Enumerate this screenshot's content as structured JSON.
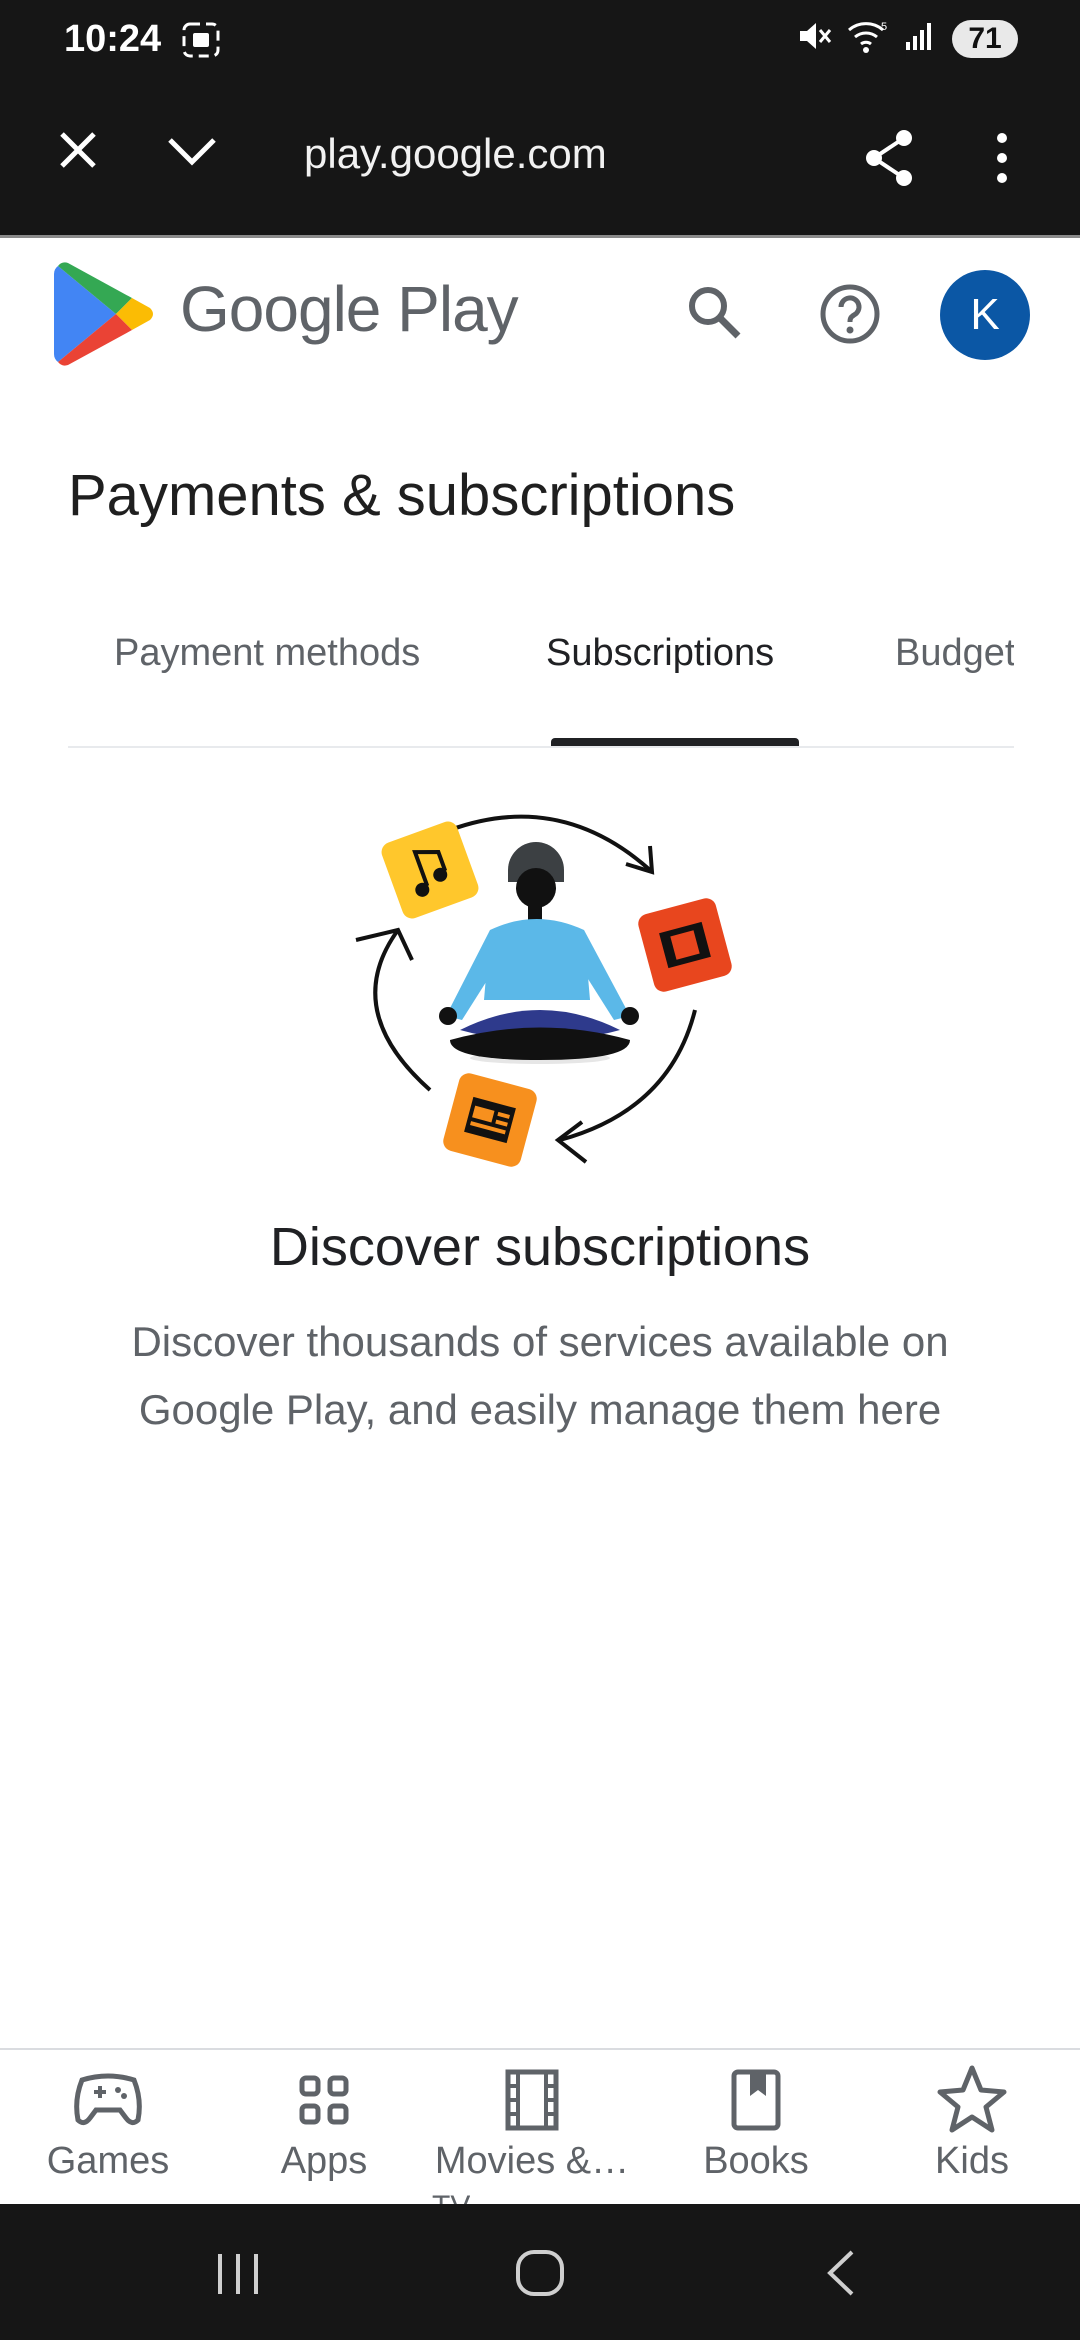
{
  "status_bar": {
    "time": "10:24",
    "battery": "71"
  },
  "browser": {
    "url": "play.google.com"
  },
  "header": {
    "brand": "Google Play",
    "avatar_initial": "K",
    "avatar_color": "#0b57a5"
  },
  "page": {
    "title": "Payments & subscriptions"
  },
  "tabs": [
    {
      "label": "Payment methods",
      "active": false
    },
    {
      "label": "Subscriptions",
      "active": true
    },
    {
      "label": "Budget",
      "active": false
    }
  ],
  "empty_state": {
    "title": "Discover subscriptions",
    "description": "Discover thousands of services available on Google Play, and easily manage them here"
  },
  "bottom_nav": {
    "items": [
      {
        "label": "Games",
        "icon": "gamepad-icon"
      },
      {
        "label": "Apps",
        "icon": "apps-grid-icon"
      },
      {
        "label": "Movies &…",
        "icon": "film-icon"
      },
      {
        "label": "Books",
        "icon": "book-icon"
      },
      {
        "label": "Kids",
        "icon": "star-icon"
      }
    ],
    "overflow_text": "TV"
  }
}
